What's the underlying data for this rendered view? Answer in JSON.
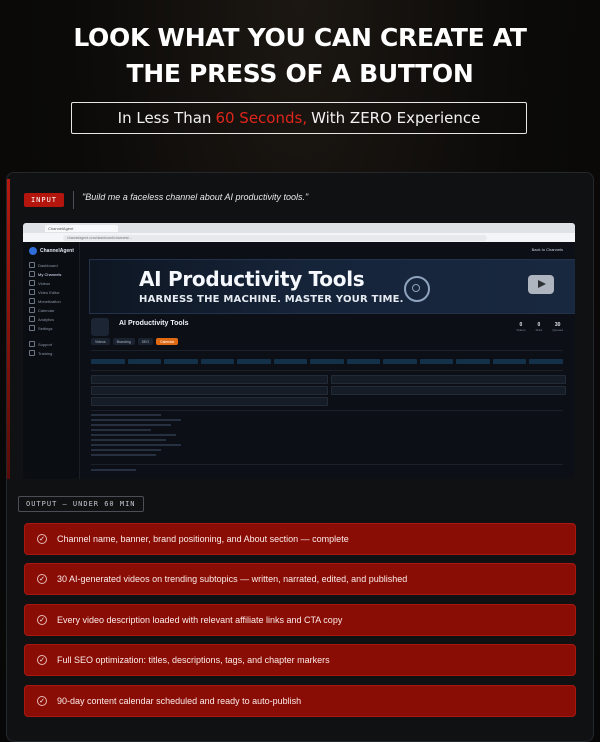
{
  "headline": {
    "line1": "LOOK WHAT YOU CAN CREATE AT",
    "line2": "THE PRESS OF A BUTTON"
  },
  "subheadline": {
    "before": "In Less Than",
    "highlight": "60 Seconds,",
    "after": "With ZERO Experience"
  },
  "input": {
    "tag": "INPUT",
    "prompt": "\"Build me a faceless channel about AI productivity tools.\""
  },
  "screenshot": {
    "browser_tab": "ChannelAgent",
    "url": "channelagent.com/dashboard/channels/...",
    "logo_text": "ChannelAgent",
    "back_link": "Back to Channels",
    "nav": [
      "Dashboard",
      "My Channels",
      "Videos",
      "Video Editor",
      "Monetization",
      "Calendar",
      "Analytics",
      "Settings",
      "Support",
      "Training"
    ],
    "banner_title": "AI Productivity Tools",
    "banner_subtitle": "HARNESS THE MACHINE. MASTER YOUR TIME.",
    "channel_name": "AI Productivity Tools",
    "stats": [
      {
        "value": "0",
        "label": "Videos"
      },
      {
        "value": "0",
        "label": "Subs"
      },
      {
        "value": "30",
        "label": "Queued"
      }
    ],
    "tabs": [
      "Videos",
      "Branding",
      "SEO",
      "Calendar"
    ],
    "active_tab": "Calendar"
  },
  "output": {
    "tag": "OUTPUT — UNDER 60 MIN",
    "items": [
      "Channel name, banner, brand positioning, and About section — complete",
      "30 AI-generated videos on trending subtopics — written, narrated, edited, and published",
      "Every video description loaded with relevant affiliate links and CTA copy",
      "Full SEO optimization: titles, descriptions, tags, and chapter markers",
      "90-day content calendar scheduled and ready to auto-publish"
    ]
  },
  "colors": {
    "accent_red": "#e0251b",
    "item_bg": "#8a0d05",
    "tab_active": "#e06a14"
  }
}
